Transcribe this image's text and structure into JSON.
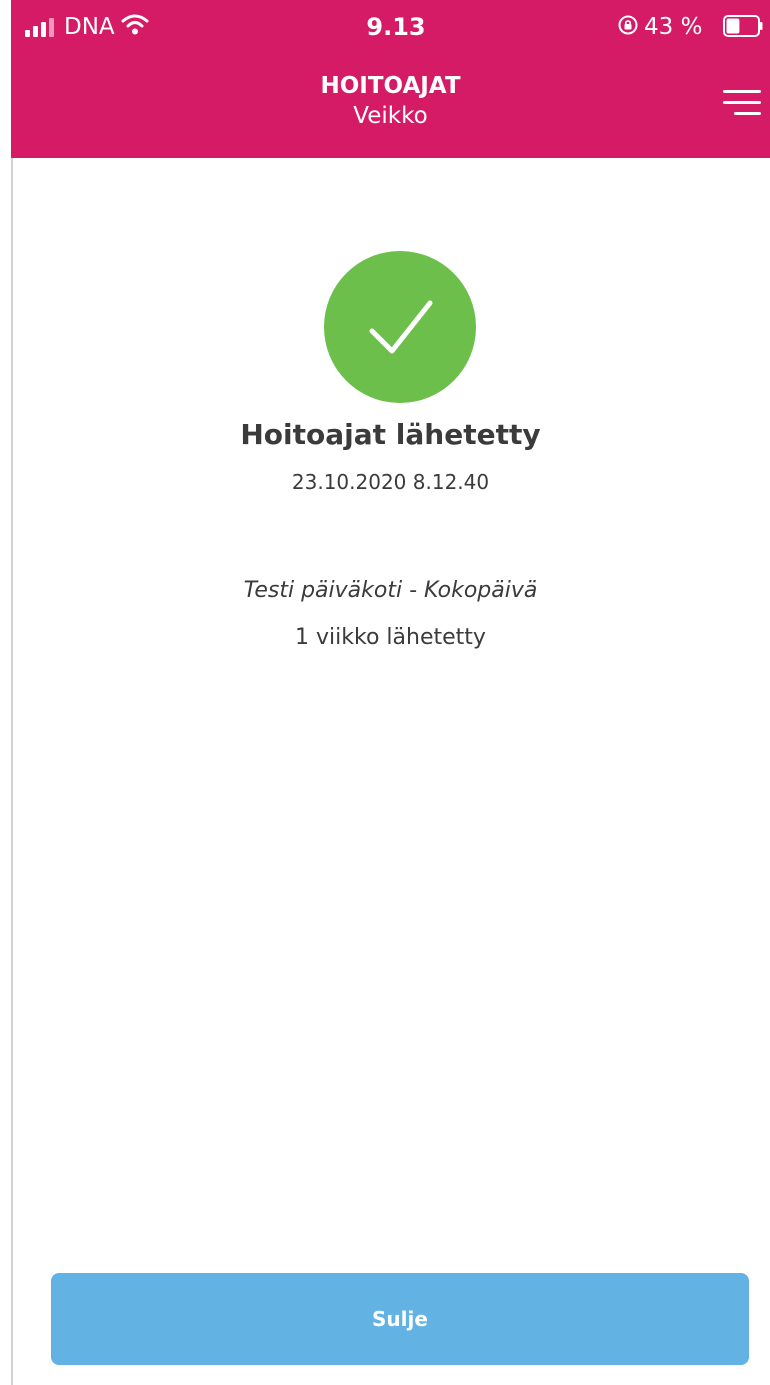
{
  "status_bar": {
    "carrier": "DNA",
    "time": "9.13",
    "battery": "43 %",
    "battery_level": 0.43,
    "icons": [
      "signal-icon",
      "wifi-icon",
      "orientation-lock-icon",
      "battery-icon"
    ]
  },
  "header": {
    "title": "HOITOAJAT",
    "subtitle": "Veikko",
    "menu_icon": "hamburger-menu-icon",
    "background_color": "#d61b66"
  },
  "confirmation": {
    "icon": "checkmark-icon",
    "icon_background_color": "#6cbf4b",
    "title": "Hoitoajat lähetetty",
    "timestamp": "23.10.2020 8.12.40",
    "place": "Testi päiväkoti - Kokopäivä",
    "weeks_sent": "1 viikko lähetetty"
  },
  "actions": {
    "close_label": "Sulje",
    "close_color": "#62b2e4"
  }
}
